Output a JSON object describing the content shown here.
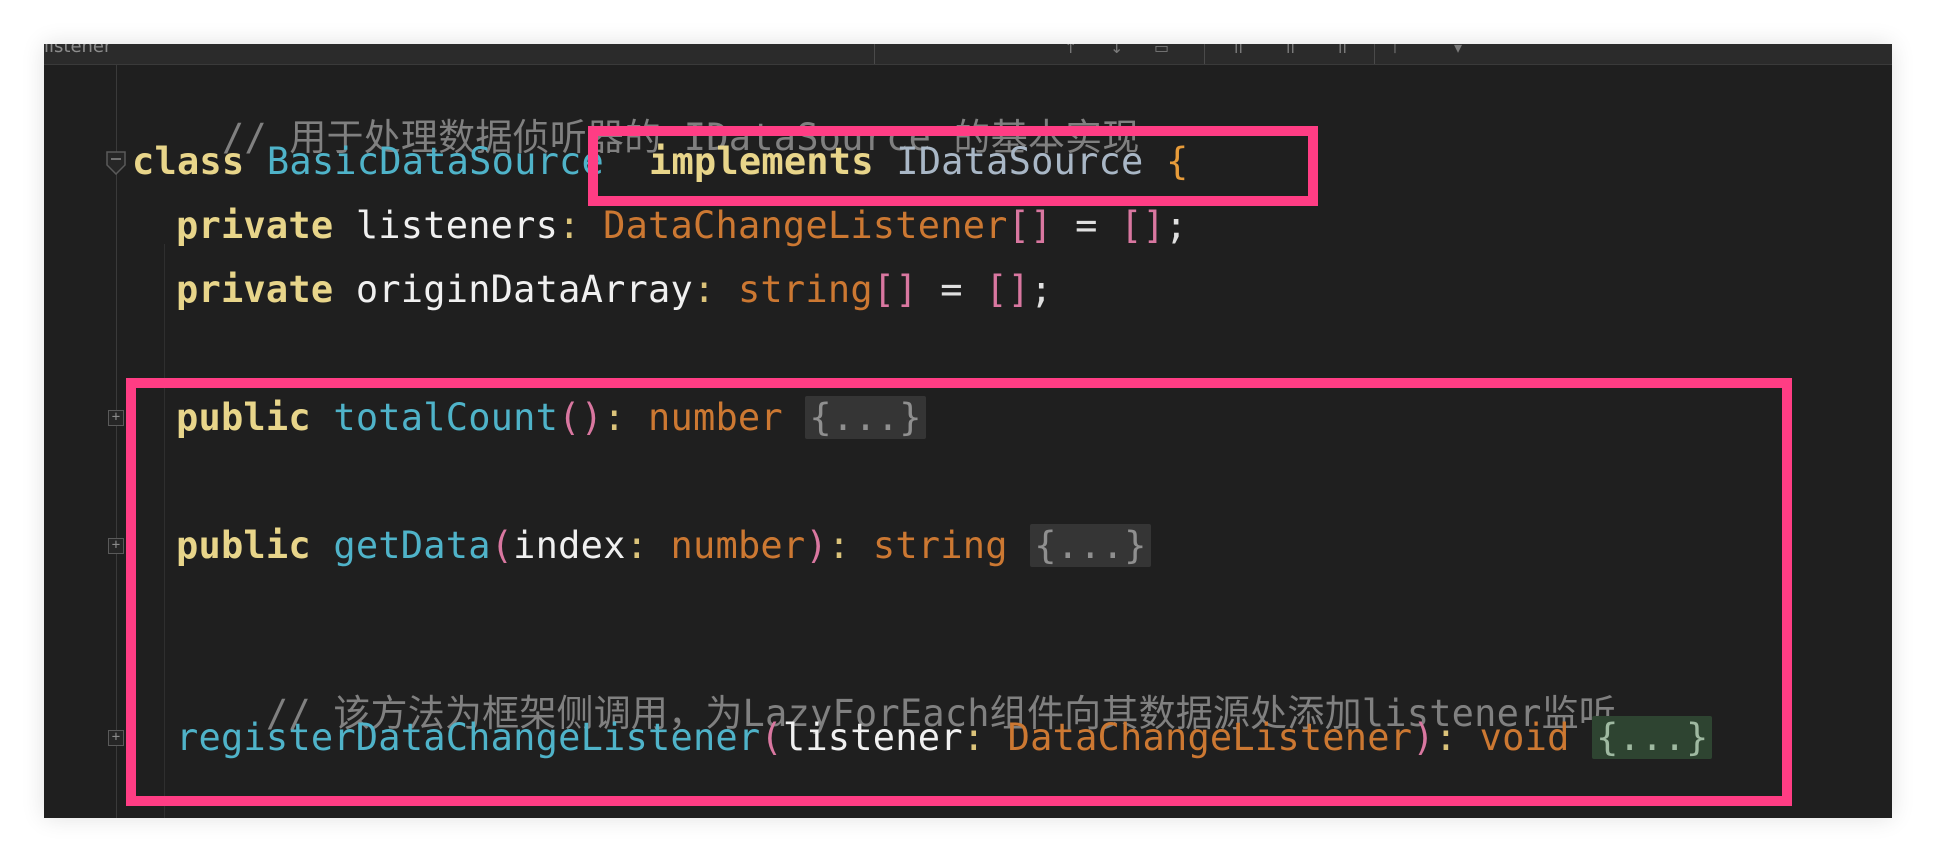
{
  "toolbar": {
    "file_tab": "listener"
  },
  "code": {
    "line1_comment": "// 用于处理数据侦听器的 IDataSource 的基本实现",
    "line2": {
      "kw_class": "class",
      "class_name": "BasicDataSource",
      "kw_implements": "implements",
      "iface": "IDataSource",
      "brace": "{"
    },
    "line3": {
      "kw": "private",
      "name": "listeners",
      "colon": ":",
      "type": "DataChangeListener",
      "brackets": "[]",
      "eq": "=",
      "init": "[]",
      "semi": ";"
    },
    "line4": {
      "kw": "private",
      "name": "originDataArray",
      "colon": ":",
      "type": "string",
      "brackets": "[]",
      "eq": "=",
      "init": "[]",
      "semi": ";"
    },
    "line5": {
      "kw": "public",
      "fn": "totalCount",
      "parens": "()",
      "colon": ":",
      "type": "number",
      "collapsed": "{...}"
    },
    "line6": {
      "kw": "public",
      "fn": "getData",
      "paren_open": "(",
      "param": "index",
      "colon1": ":",
      "param_type": "number",
      "paren_close": ")",
      "colon2": ":",
      "ret_type": "string",
      "collapsed": "{...}"
    },
    "line7_comment": "// 该方法为框架侧调用，为LazyForEach组件向其数据源处添加listener监听",
    "line8": {
      "fn": "registerDataChangeListener",
      "paren_open": "(",
      "param": "listener",
      "colon1": ":",
      "param_type": "DataChangeListener",
      "paren_close": ")",
      "colon2": ":",
      "ret_type": "void",
      "collapsed": "{...}"
    }
  },
  "gutter": {
    "fold_open": "−",
    "fold_closed": "+"
  },
  "colors": {
    "highlight": "#ff3d84",
    "background": "#1f1f1f",
    "keyword": "#e8d58a",
    "function": "#4fb3c9",
    "type": "#cc7832",
    "comment": "#808080"
  }
}
